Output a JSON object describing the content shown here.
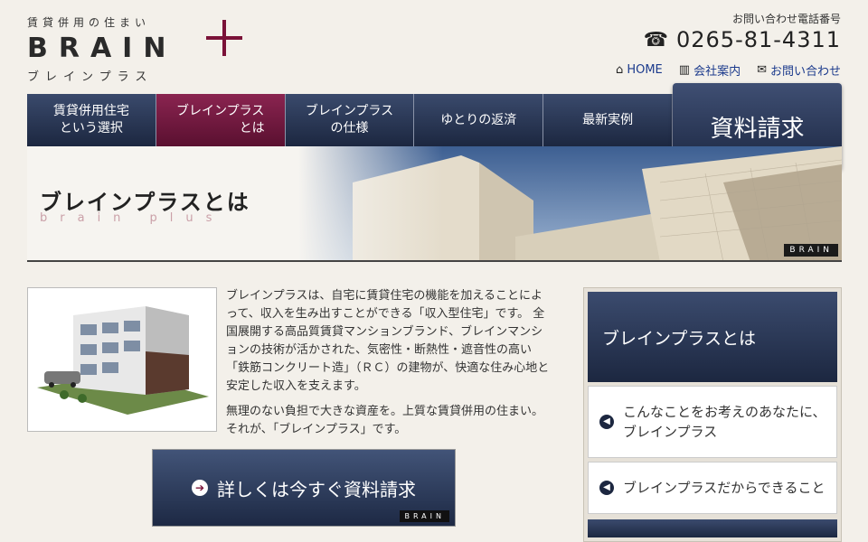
{
  "logo": {
    "tagline": "賃貸併用の住まい",
    "main": "BRAIN",
    "kana": "ブレインプラス"
  },
  "contact": {
    "label": "お問い合わせ電話番号",
    "phone": "0265-81-4311"
  },
  "toplinks": [
    {
      "label": "HOME",
      "icon": "home-icon"
    },
    {
      "label": "会社案内",
      "icon": "building-icon"
    },
    {
      "label": "お問い合わせ",
      "icon": "mail-icon"
    }
  ],
  "nav": [
    {
      "line1": "賃貸併用住宅",
      "line2": "という選択"
    },
    {
      "line1": "ブレインプラス",
      "line2": "とは"
    },
    {
      "line1": "ブレインプラス",
      "line2": "の仕様"
    },
    {
      "line1": "ゆとりの返済",
      "line2": ""
    },
    {
      "line1": "最新実例",
      "line2": ""
    }
  ],
  "nav_active_index": 1,
  "request_button": "資料請求",
  "hero": {
    "title": "ブレインプラスとは",
    "subtitle": "brain plus",
    "badge": "BRAIN"
  },
  "description": {
    "p1": "ブレインプラスは、自宅に賃貸住宅の機能を加えることによって、収入を生み出すことができる「収入型住宅」です。 全国展開する高品質賃貸マンションブランド、ブレインマンションの技術が活かされた、気密性・断熱性・遮音性の高い「鉄筋コンクリート造」（ＲＣ）の建物が、快適な住み心地と安定した収入を支えます。",
    "p2": "無理のない負担で大きな資産を。上質な賃貸併用の住まい。それが、「ブレインプラス」です。"
  },
  "cta": {
    "label": "詳しくは今すぐ資料請求",
    "badge": "BRAIN"
  },
  "sidebar": {
    "title": "ブレインプラスとは",
    "items": [
      {
        "label": "こんなことをお考えのあなたに、ブレインプラス"
      },
      {
        "label": "ブレインプラスだからできること"
      }
    ]
  },
  "colors": {
    "navy": "#1c2740",
    "accent": "#7a1238",
    "link": "#1b3a8c",
    "background": "#f3f0ea"
  }
}
